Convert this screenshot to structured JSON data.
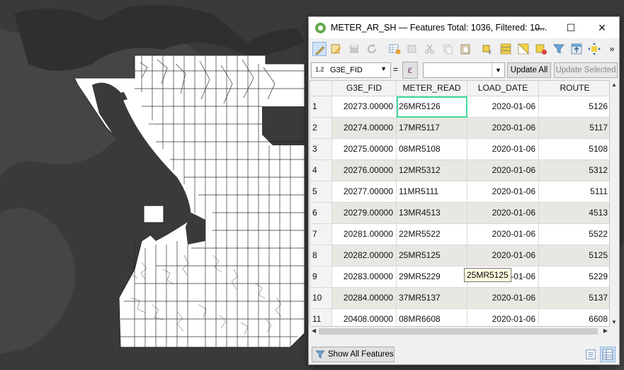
{
  "window": {
    "title": "METER_AR_SH — Features Total: 1036, Filtered: 10...",
    "minimize": "—",
    "maximize": "☐",
    "close": "✕"
  },
  "toolbar": {
    "buttons": [
      "toggle-editing",
      "multi-edit",
      "save-edits",
      "reload",
      "add-feature",
      "delete-feature",
      "cut",
      "copy",
      "paste",
      "expression-select",
      "select-all",
      "invert-selection",
      "deselect-all",
      "pan-to-selected",
      "filter",
      "move-selection-top",
      "zoom-to-selected",
      "pan-map"
    ],
    "more": "»"
  },
  "fieldbar": {
    "field_type": "1.2",
    "field_name": "G3E_FID",
    "equals": "=",
    "expression_symbol": "ε",
    "value": "",
    "update_all": "Update All",
    "update_selected": "Update Selected"
  },
  "table": {
    "columns": [
      "G3E_FID",
      "METER_READ",
      "LOAD_DATE",
      "ROUTE"
    ],
    "rows": [
      {
        "n": "1",
        "fid": "20273.00000",
        "meter": "26MR5126",
        "date": "2020-01-06",
        "route": "5126"
      },
      {
        "n": "2",
        "fid": "20274.00000",
        "meter": "17MR5117",
        "date": "2020-01-06",
        "route": "5117"
      },
      {
        "n": "3",
        "fid": "20275.00000",
        "meter": "08MR5108",
        "date": "2020-01-06",
        "route": "5108"
      },
      {
        "n": "4",
        "fid": "20276.00000",
        "meter": "12MR5312",
        "date": "2020-01-06",
        "route": "5312"
      },
      {
        "n": "5",
        "fid": "20277.00000",
        "meter": "11MR5111",
        "date": "2020-01-06",
        "route": "5111"
      },
      {
        "n": "6",
        "fid": "20279.00000",
        "meter": "13MR4513",
        "date": "2020-01-06",
        "route": "4513"
      },
      {
        "n": "7",
        "fid": "20281.00000",
        "meter": "22MR5522",
        "date": "2020-01-06",
        "route": "5522"
      },
      {
        "n": "8",
        "fid": "20282.00000",
        "meter": "25MR5125",
        "date": "2020-01-06",
        "route": "5125"
      },
      {
        "n": "9",
        "fid": "20283.00000",
        "meter": "29MR5229",
        "date": "2020-01-06",
        "route": "5229"
      },
      {
        "n": "10",
        "fid": "20284.00000",
        "meter": "37MR5137",
        "date": "2020-01-06",
        "route": "5137"
      },
      {
        "n": "11",
        "fid": "20408.00000",
        "meter": "08MR6608",
        "date": "2020-01-06",
        "route": "6608"
      }
    ],
    "tooltip": "25MR5125"
  },
  "footer": {
    "show_features": "Show All Features"
  },
  "colors": {
    "map_background": "#3b3b3b",
    "map_land": "#ffffff",
    "selection_outline": "#3fdb9a",
    "alt_row": "#e9e7e2"
  }
}
